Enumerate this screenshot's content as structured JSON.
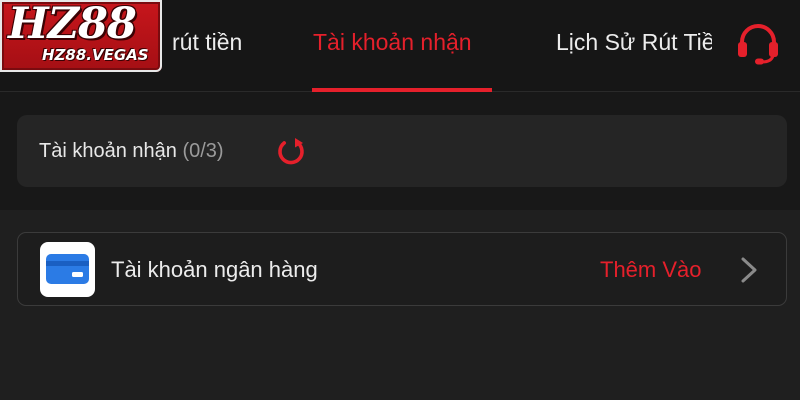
{
  "logo": {
    "main": "HZ88",
    "sub": "HZ88.VEGAS"
  },
  "tabs": [
    {
      "label": "rút tiền",
      "active": false
    },
    {
      "label": "Tài khoản nhận",
      "active": true
    },
    {
      "label": "Lịch Sử Rút Tiền",
      "active": false
    }
  ],
  "summary": {
    "label": "Tài khoản nhận",
    "count": "(0/3)"
  },
  "bank_account": {
    "label": "Tài khoản ngân hàng",
    "action": "Thêm Vào"
  },
  "icons": {
    "support": "headset-icon",
    "refresh": "refresh-icon",
    "bank": "bank-card-icon",
    "chevron": "chevron-right-icon"
  },
  "colors": {
    "accent": "#e5202b",
    "background": "#181818",
    "panel": "#252525",
    "bank_icon": "#2b7be5"
  }
}
